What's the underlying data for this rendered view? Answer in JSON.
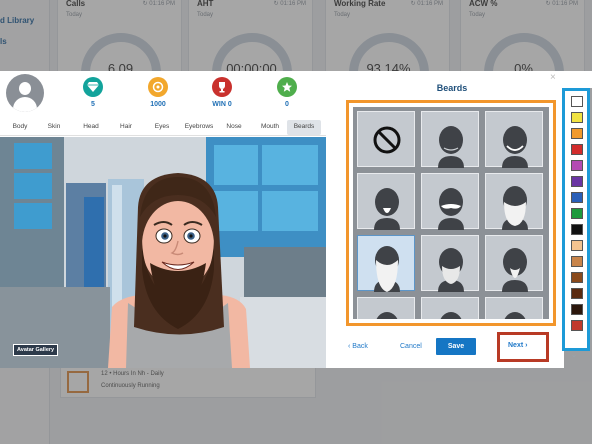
{
  "background": {
    "sidebar_items": [
      "d Library",
      "ls"
    ],
    "cards": [
      {
        "title": "Calls",
        "sub": "Today",
        "time": "↻ 01:16 PM",
        "value": "6.09"
      },
      {
        "title": "AHT",
        "sub": "Today",
        "time": "↻ 01:16 PM",
        "value": "00:00:00"
      },
      {
        "title": "Working Rate",
        "sub": "Today",
        "time": "↻ 01:16 PM",
        "value": "93.14%"
      },
      {
        "title": "ACW %",
        "sub": "Today",
        "time": "↻ 01:16 PM",
        "value": "0%"
      }
    ],
    "row_line1": "12 • Hours In Nh - Daily",
    "row_line2": "Continuously Running"
  },
  "stats": [
    {
      "icon": "diamond-icon",
      "value": "5",
      "color": "#12a39b"
    },
    {
      "icon": "coins-icon",
      "value": "1000",
      "color": "#f2a72c"
    },
    {
      "icon": "trophy-icon",
      "value": "WIN 0",
      "color": "#c9312d"
    },
    {
      "icon": "star-badge-icon",
      "value": "0",
      "color": "#4fae4c"
    }
  ],
  "tabs": [
    "Body",
    "Skin",
    "Head",
    "Hair",
    "Eyes",
    "Eyebrows",
    "Nose",
    "Mouth",
    "Beards"
  ],
  "active_tab": "Beards",
  "gallery_button": "Avatar Gallery",
  "panel_title": "Beards",
  "beard_options": [
    "none",
    "stubble",
    "chin-strap",
    "goatee",
    "mustache",
    "full-beard",
    "long-beard",
    "full-beard-white",
    "goatee-long",
    "partial-row-1",
    "partial-row-2",
    "partial-row-3"
  ],
  "selected_beard_index": 6,
  "back_label": "‹ Back",
  "cancel_label": "Cancel",
  "save_label": "Save",
  "next_label": "Next ›",
  "close_label": "×",
  "colors": [
    "#ffffff",
    "#f1e342",
    "#f29a2c",
    "#d22c2c",
    "#b44bb3",
    "#6a35a3",
    "#2a5fb8",
    "#1e9a3c",
    "#111111",
    "#f4c38f",
    "#c8844a",
    "#8a4a1c",
    "#5a2a10",
    "#2c170c",
    "#c0392b"
  ],
  "accent_orange": "#f2962c",
  "accent_red": "#b83a25",
  "accent_blue": "#1d9ad7"
}
